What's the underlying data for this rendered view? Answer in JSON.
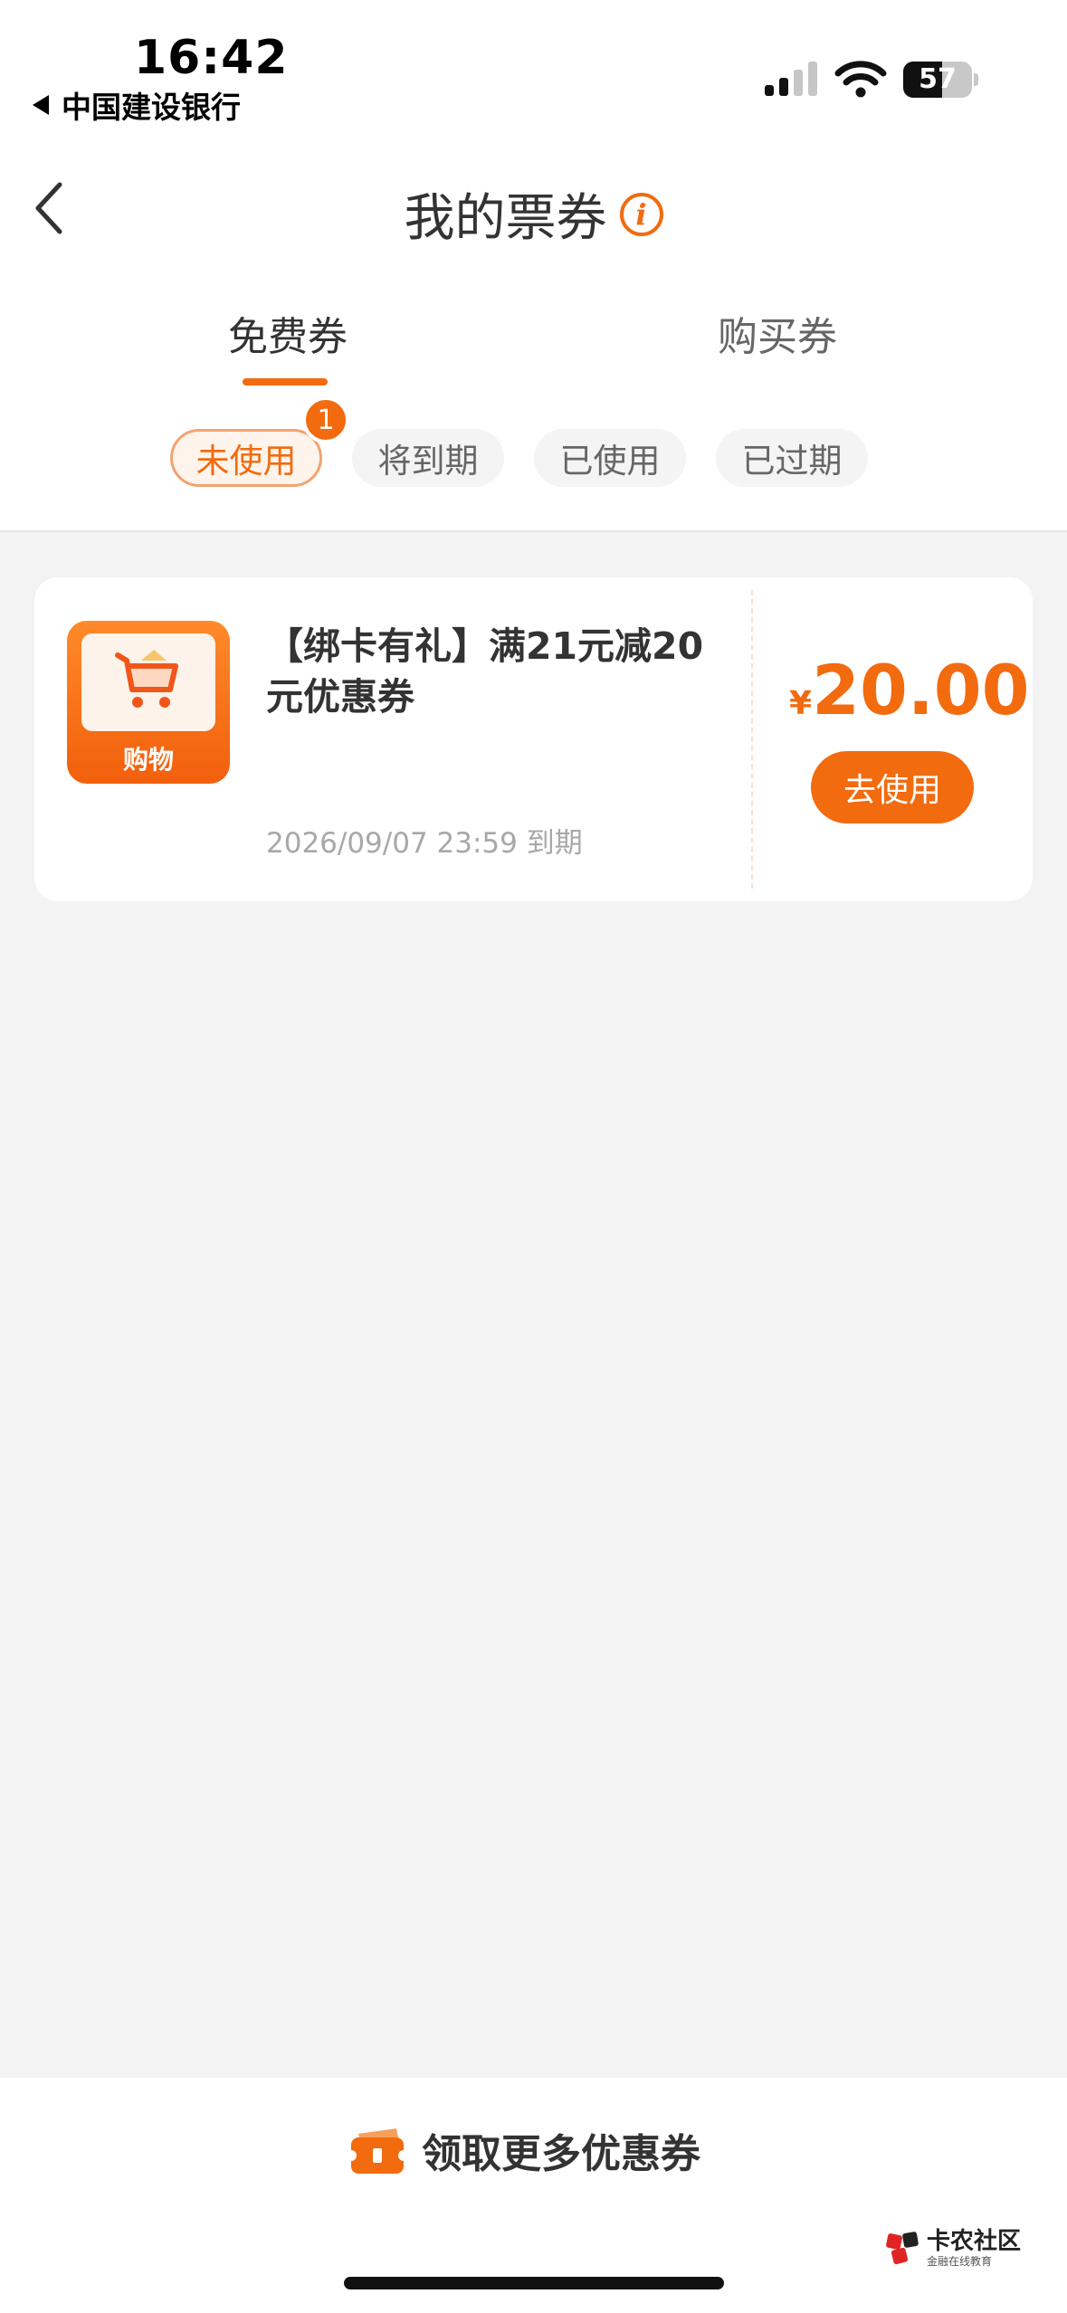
{
  "status_bar": {
    "time": "16:42",
    "back_app": "中国建设银行",
    "battery": "57",
    "battery_level": 0.57
  },
  "header": {
    "title": "我的票券"
  },
  "tabs": [
    {
      "label": "免费券",
      "selected": true
    },
    {
      "label": "购买券",
      "selected": false
    }
  ],
  "filters": [
    {
      "label": "未使用",
      "selected": true
    },
    {
      "label": "将到期",
      "selected": false
    },
    {
      "label": "已使用",
      "selected": false
    },
    {
      "label": "已过期",
      "selected": false
    }
  ],
  "unused_badge": "1",
  "coupon": {
    "icon_label": "购物",
    "title": "【绑卡有礼】满21元减20元优惠券",
    "expiry": "2026/09/07 23:59 到期",
    "currency": "¥",
    "amount": "20.00",
    "action": "去使用"
  },
  "bottom": {
    "more_label": "领取更多优惠券"
  },
  "watermark": {
    "name": "卡农社区",
    "sub": "金融在线教育"
  },
  "colors": {
    "accent": "#f26b0f",
    "background": "#f3f3f3"
  }
}
